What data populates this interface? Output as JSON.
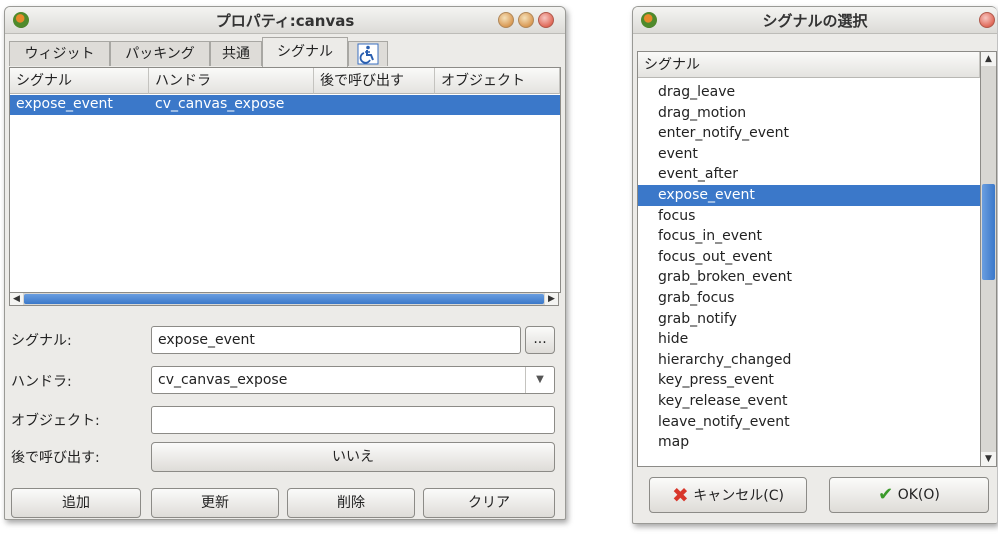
{
  "props_window": {
    "title": "プロパティ:canvas",
    "tabs": [
      "ウィジット",
      "パッキング",
      "共通",
      "シグナル"
    ],
    "accessibility_tab_icon": "accessibility-icon",
    "columns": [
      "シグナル",
      "ハンドラ",
      "後で呼び出す",
      "オブジェクト"
    ],
    "rows": [
      {
        "signal": "expose_event",
        "handler": "cv_canvas_expose",
        "after": "",
        "object": ""
      }
    ],
    "form": {
      "signal_label": "シグナル:",
      "signal_value": "expose_event",
      "signal_browse": "...",
      "handler_label": "ハンドラ:",
      "handler_value": "cv_canvas_expose",
      "object_label": "オブジェクト:",
      "object_value": "",
      "after_label": "後で呼び出す:",
      "after_value": "いいえ"
    },
    "buttons": {
      "add": "追加",
      "update": "更新",
      "delete": "削除",
      "clear": "クリア"
    }
  },
  "select_window": {
    "title": "シグナルの選択",
    "column": "シグナル",
    "items": [
      "drag_leave",
      "drag_motion",
      "enter_notify_event",
      "event",
      "event_after",
      "expose_event",
      "focus",
      "focus_in_event",
      "focus_out_event",
      "grab_broken_event",
      "grab_focus",
      "grab_notify",
      "hide",
      "hierarchy_changed",
      "key_press_event",
      "key_release_event",
      "leave_notify_event",
      "map"
    ],
    "selected_index": 5,
    "cancel": "キャンセル(C)",
    "ok": "OK(O)"
  },
  "colors": {
    "selection": "#3b78c9",
    "window_bg": "#ecebe8"
  }
}
